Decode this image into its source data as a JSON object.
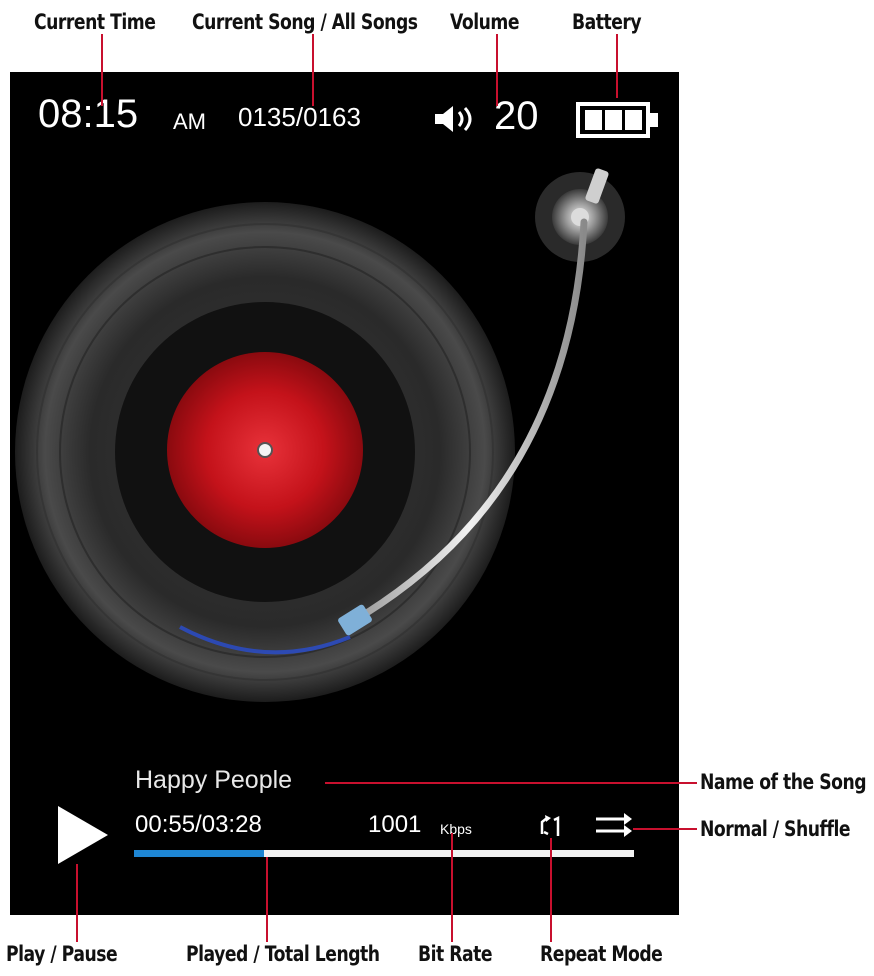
{
  "callouts": {
    "current_time": "Current Time",
    "current_song": "Current Song / All Songs",
    "volume": "Volume",
    "battery": "Battery",
    "song_name": "Name of the Song",
    "shuffle": "Normal / Shuffle",
    "play_pause": "Play / Pause",
    "played_total": "Played / Total Length",
    "bit_rate": "Bit Rate",
    "repeat_mode": "Repeat Mode"
  },
  "status": {
    "time": "08:15",
    "ampm": "AM",
    "song_count": "0135/0163",
    "volume": "20"
  },
  "player": {
    "song_name": "Happy People",
    "played": "00:55/03:28",
    "bitrate": "1001",
    "bitrate_unit": "Kbps",
    "progress_fraction": 0.26
  },
  "icons": {
    "volume": "speaker-icon",
    "battery": "battery-full-icon",
    "play": "play-icon",
    "repeat": "repeat-one-icon",
    "shuffle": "shuffle-icon"
  },
  "colors": {
    "leader": "#c8102e",
    "record_label": "#c4121a",
    "progress": "#1e86d4"
  }
}
